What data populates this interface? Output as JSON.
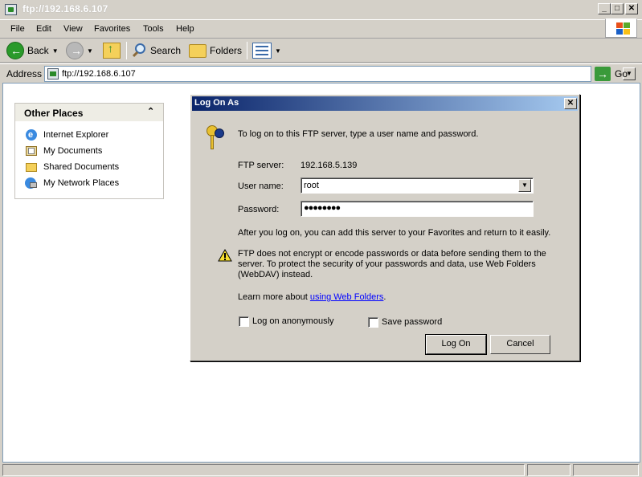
{
  "window": {
    "title": "ftp://192.168.6.107"
  },
  "menu": [
    "File",
    "Edit",
    "View",
    "Favorites",
    "Tools",
    "Help"
  ],
  "toolbar": {
    "back_label": "Back",
    "search_label": "Search",
    "folders_label": "Folders"
  },
  "address": {
    "label": "Address",
    "value": "ftp://192.168.6.107",
    "go_label": "Go"
  },
  "other_places": {
    "title": "Other Places",
    "items": [
      {
        "label": "Internet Explorer",
        "icon": "internet-explorer-icon"
      },
      {
        "label": "My Documents",
        "icon": "my-documents-icon"
      },
      {
        "label": "Shared Documents",
        "icon": "folder-icon"
      },
      {
        "label": "My Network Places",
        "icon": "network-places-icon"
      }
    ]
  },
  "dialog": {
    "title": "Log On As",
    "intro": "To log on to this FTP server, type a user name and password.",
    "ftp_server_label": "FTP server:",
    "ftp_server_value": "192.168.5.139",
    "username_label": "User name:",
    "username_value": "root",
    "password_label": "Password:",
    "password_value": "●●●●●●●●",
    "after_logon": "After you log on, you can add this server to your Favorites and return to it easily.",
    "warning_line1": "FTP does not encrypt or encode passwords or data before sending them to the",
    "warning_line2": "server.  To protect the security of your passwords and data, use Web Folders",
    "warning_line3": "(WebDAV) instead.",
    "learn_prefix": "Learn more about ",
    "learn_link": "using Web Folders",
    "learn_suffix": ".",
    "anon_label": "Log on anonymously",
    "save_label": "Save password",
    "logon_button": "Log On",
    "cancel_button": "Cancel"
  }
}
